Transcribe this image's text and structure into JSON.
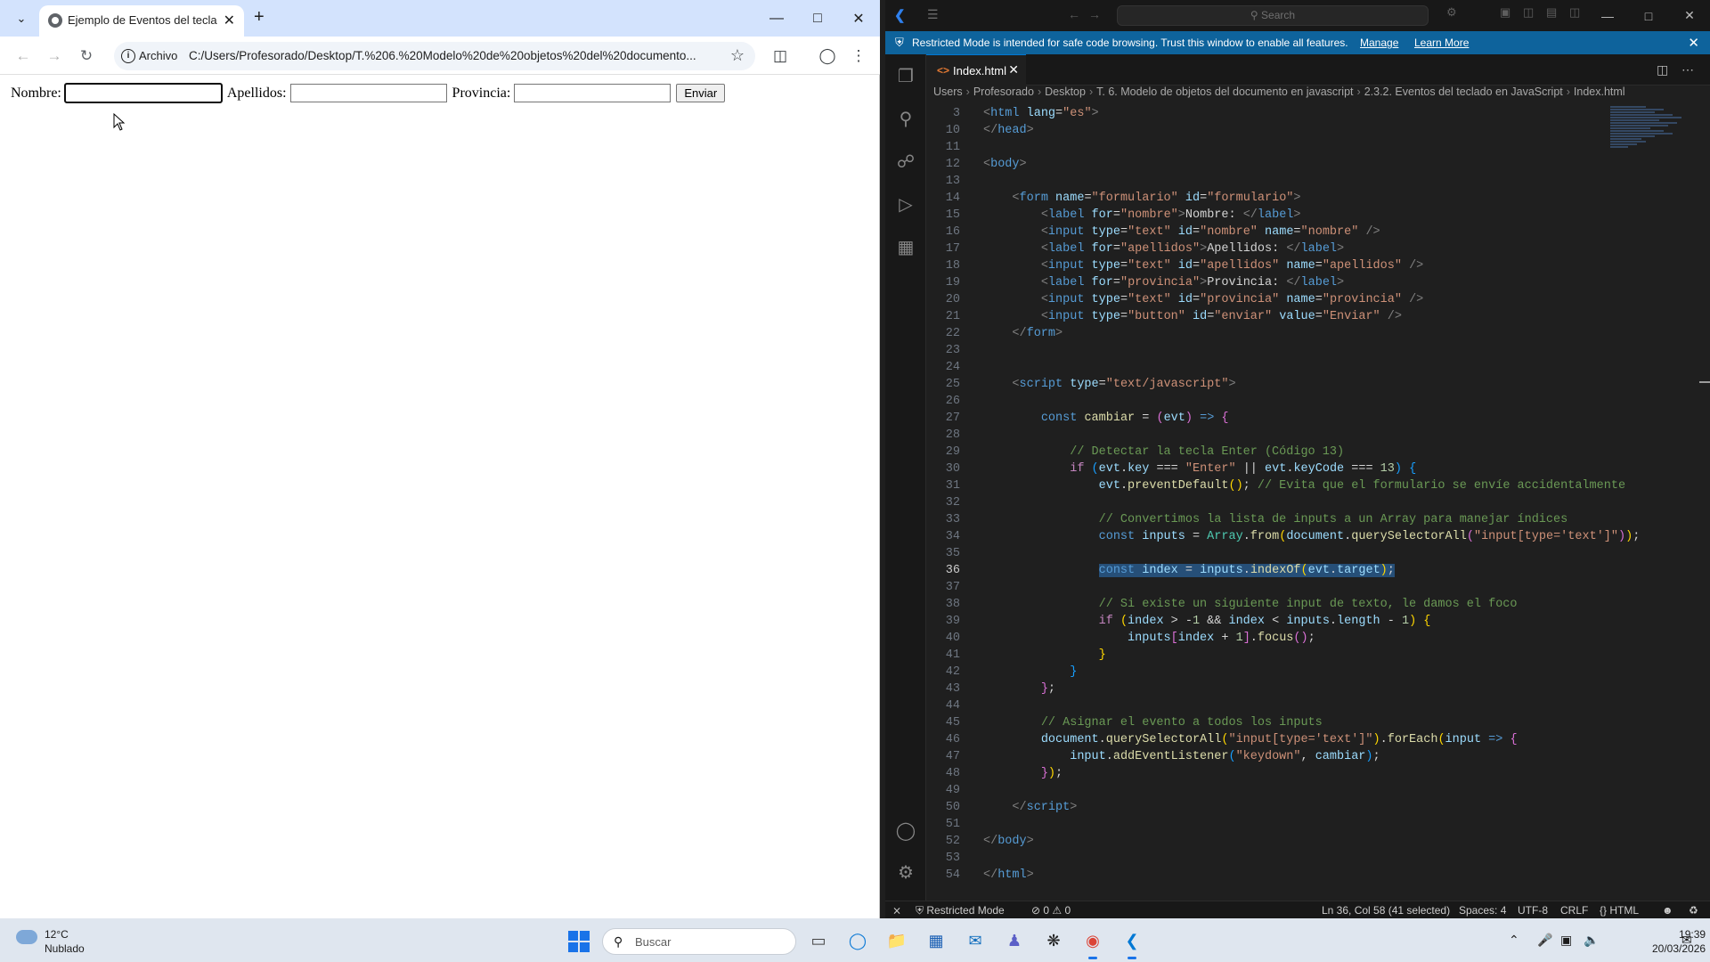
{
  "browser": {
    "tab_title": "Ejemplo de Eventos del teclado",
    "address_chip": "Archivo",
    "url": "C:/Users/Profesorado/Desktop/T.%206.%20Modelo%20de%20objetos%20del%20documento...",
    "form": {
      "nombre_label": "Nombre:",
      "apellidos_label": "Apellidos:",
      "provincia_label": "Provincia:",
      "nombre_value": "",
      "apellidos_value": "",
      "provincia_value": "",
      "submit_label": "Enviar"
    }
  },
  "vscode": {
    "search_placeholder": "Search",
    "banner": {
      "message": "Restricted Mode is intended for safe code browsing. Trust this window to enable all features.",
      "manage": "Manage",
      "learn_more": "Learn More"
    },
    "tab": {
      "file_name": "Index.html"
    },
    "breadcrumb": [
      "Users",
      "Profesorado",
      "Desktop",
      "T. 6. Modelo de objetos del documento en javascript",
      "2.3.2. Eventos del teclado en JavaScript",
      "Index.html"
    ],
    "current_line": 36,
    "line_numbers": [
      3,
      10,
      11,
      12,
      13,
      14,
      15,
      16,
      17,
      18,
      19,
      20,
      21,
      22,
      23,
      24,
      25,
      26,
      27,
      28,
      29,
      30,
      31,
      32,
      33,
      34,
      35,
      36,
      37,
      38,
      39,
      40,
      41,
      42,
      43,
      44,
      45,
      46,
      47,
      48,
      49,
      50,
      51,
      52,
      53,
      54
    ],
    "status": {
      "mode": "Restricted Mode",
      "errors": "0",
      "warnings": "0",
      "position": "Ln 36, Col 58 (41 selected)",
      "spaces": "Spaces: 4",
      "encoding": "UTF-8",
      "eol": "CRLF",
      "language": "HTML"
    }
  },
  "taskbar": {
    "temperature": "12°C",
    "weather": "Nublado",
    "search_placeholder": "Buscar",
    "time": "19:39",
    "date": "20/03/2026"
  },
  "colors": {
    "vscode_banner": "#0e639c",
    "chrome_tabbar": "#d3e3fd",
    "selection": "#264f78"
  }
}
